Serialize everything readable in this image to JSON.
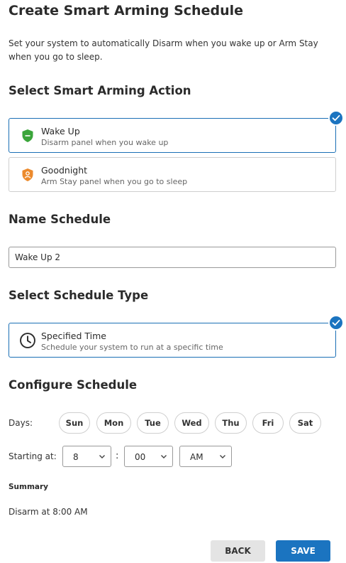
{
  "page": {
    "title": "Create Smart Arming Schedule",
    "intro": "Set your system to automatically Disarm when you wake up or Arm Stay when you go to sleep."
  },
  "action_section": {
    "heading": "Select Smart Arming Action",
    "options": [
      {
        "title": "Wake Up",
        "subtitle": "Disarm panel when you wake up",
        "icon": "shield-minus-icon",
        "icon_color": "#3aa53a",
        "selected": true
      },
      {
        "title": "Goodnight",
        "subtitle": "Arm Stay panel when you go to sleep",
        "icon": "shield-person-icon",
        "icon_color": "#ec8a2c",
        "selected": false
      }
    ]
  },
  "name_section": {
    "heading": "Name Schedule",
    "value": "Wake Up 2"
  },
  "type_section": {
    "heading": "Select Schedule Type",
    "options": [
      {
        "title": "Specified Time",
        "subtitle": "Schedule your system to run at a specific time",
        "icon": "clock-icon",
        "selected": true
      }
    ]
  },
  "configure_section": {
    "heading": "Configure Schedule",
    "days_label": "Days:",
    "days": [
      "Sun",
      "Mon",
      "Tue",
      "Wed",
      "Thu",
      "Fri",
      "Sat"
    ],
    "starting_label": "Starting at:",
    "hour": "8",
    "separator": ":",
    "minute": "00",
    "period": "AM"
  },
  "summary": {
    "heading": "Summary",
    "text": "Disarm at 8:00 AM"
  },
  "buttons": {
    "back": "BACK",
    "save": "SAVE"
  },
  "colors": {
    "accent": "#1b74c0",
    "selected_border": "#1a6fb5",
    "back_bg": "#e4e4e4"
  }
}
